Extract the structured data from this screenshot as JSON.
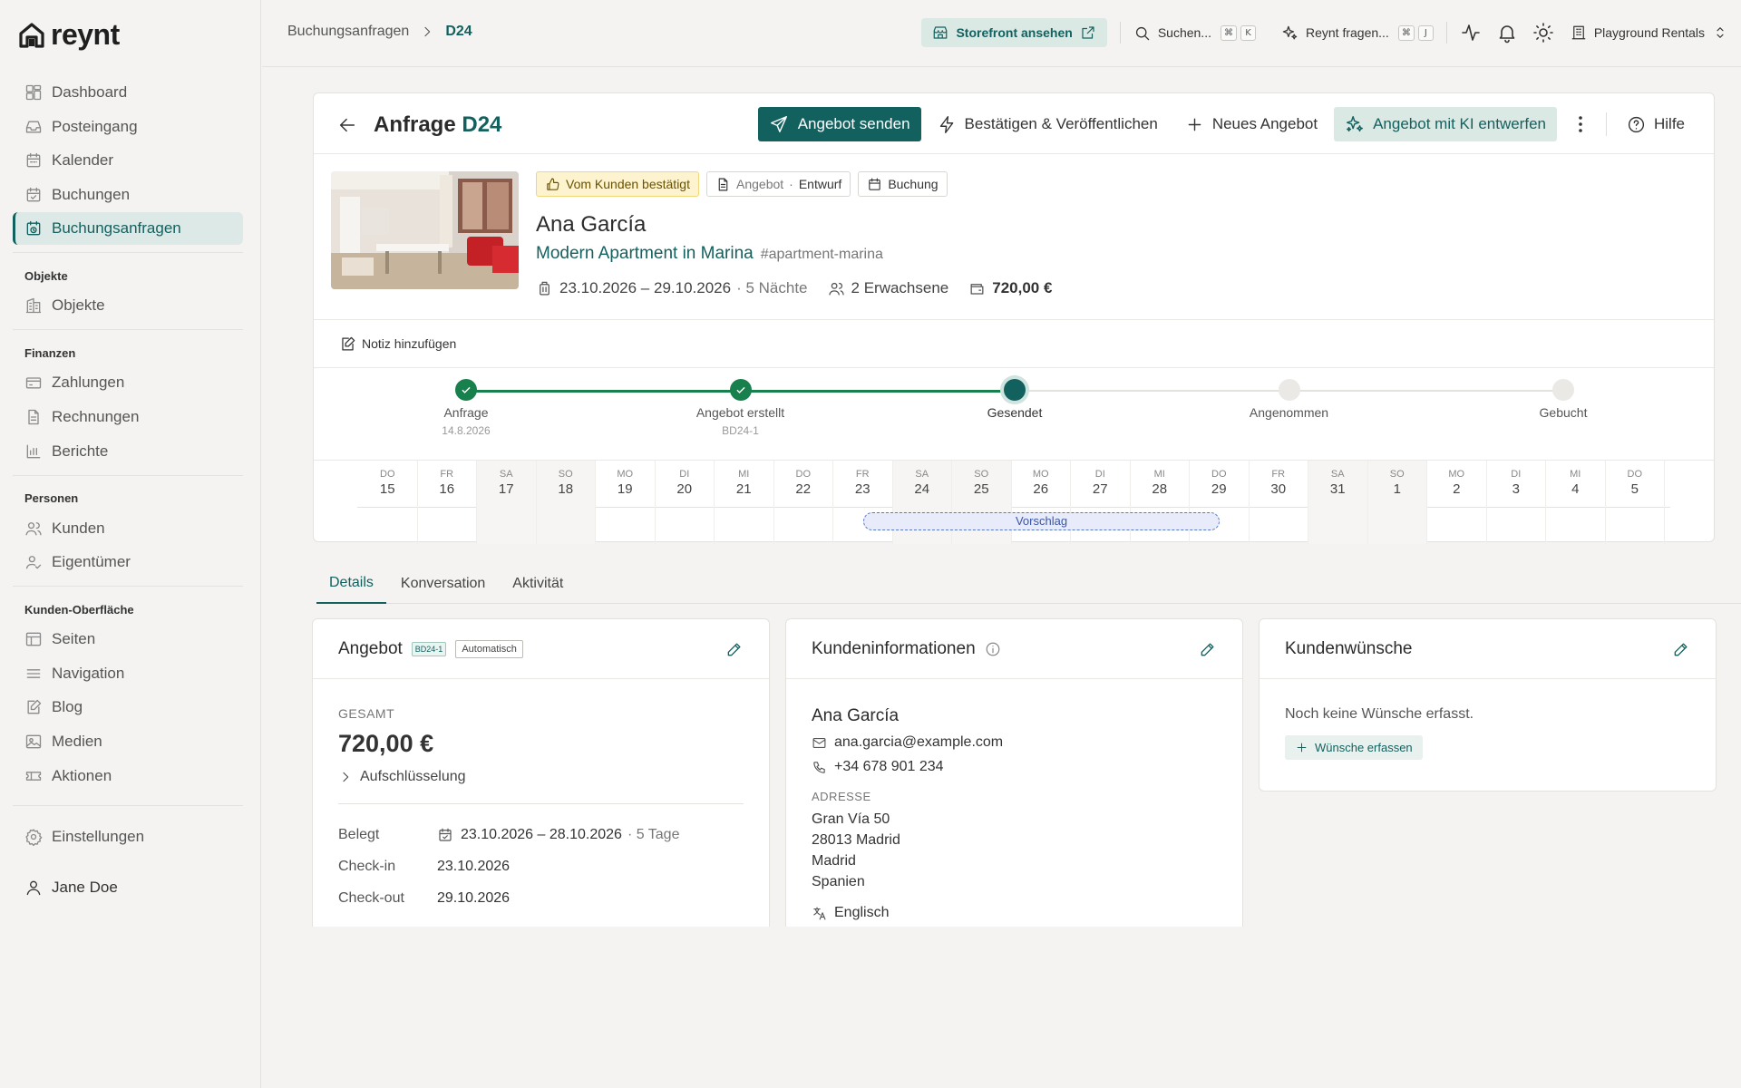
{
  "app": {
    "logo_text": "reynt"
  },
  "sidebar": {
    "group1": [
      {
        "label": "Dashboard",
        "icon": "dashboard-icon"
      },
      {
        "label": "Posteingang",
        "icon": "inbox-icon"
      },
      {
        "label": "Kalender",
        "icon": "calendar-icon"
      },
      {
        "label": "Buchungen",
        "icon": "bookings-icon"
      },
      {
        "label": "Buchungsanfragen",
        "icon": "booking-requests-icon",
        "active": true
      }
    ],
    "sections": {
      "objekte": "Objekte",
      "finanzen": "Finanzen",
      "personen": "Personen",
      "kunden_oberflaeche": "Kunden-Oberfläche"
    },
    "objekte": [
      {
        "label": "Objekte",
        "icon": "building-icon"
      }
    ],
    "finanzen": [
      {
        "label": "Zahlungen",
        "icon": "payments-icon"
      },
      {
        "label": "Rechnungen",
        "icon": "invoices-icon"
      },
      {
        "label": "Berichte",
        "icon": "reports-icon"
      }
    ],
    "personen": [
      {
        "label": "Kunden",
        "icon": "customers-icon"
      },
      {
        "label": "Eigentümer",
        "icon": "owners-icon"
      }
    ],
    "kunden_oberflaeche": [
      {
        "label": "Seiten",
        "icon": "pages-icon"
      },
      {
        "label": "Navigation",
        "icon": "navigation-icon"
      },
      {
        "label": "Blog",
        "icon": "blog-icon"
      },
      {
        "label": "Medien",
        "icon": "media-icon"
      },
      {
        "label": "Aktionen",
        "icon": "promotions-icon"
      }
    ],
    "settings": "Einstellungen",
    "user": "Jane Doe"
  },
  "topbar": {
    "breadcrumb_parent": "Buchungsanfragen",
    "breadcrumb_current": "D24",
    "storefront_label": "Storefront ansehen",
    "search_label": "Suchen...",
    "search_keys": [
      "⌘",
      "K"
    ],
    "ask_label": "Reynt fragen...",
    "ask_keys": [
      "⌘",
      "J"
    ],
    "org_name": "Playground Rentals"
  },
  "request": {
    "title_prefix": "Anfrage",
    "title_code": "D24",
    "actions": {
      "send_offer": "Angebot senden",
      "confirm_publish": "Bestätigen & Veröffentlichen",
      "new_offer": "Neues Angebot",
      "ai_draft": "Angebot mit KI entwerfen",
      "help": "Hilfe"
    },
    "badges": {
      "confirmed": "Vom Kunden bestätigt",
      "offer_prefix": "Angebot",
      "offer_sep": "·",
      "offer_state": "Entwurf",
      "booking": "Buchung"
    },
    "guest_name": "Ana García",
    "listing_name": "Modern Apartment in Marina",
    "listing_slug": "#apartment-marina",
    "dates": "23.10.2026 – 29.10.2026",
    "nights": "· 5 Nächte",
    "guests": "2 Erwachsene",
    "price": "720,00 €",
    "add_note": "Notiz hinzufügen"
  },
  "steps": [
    {
      "label": "Anfrage",
      "sub": "14.8.2026",
      "state": "done"
    },
    {
      "label": "Angebot erstellt",
      "sub": "BD24-1",
      "state": "done"
    },
    {
      "label": "Gesendet",
      "sub": "",
      "state": "current"
    },
    {
      "label": "Angenommen",
      "sub": "",
      "state": "todo"
    },
    {
      "label": "Gebucht",
      "sub": "",
      "state": "todo"
    }
  ],
  "calendar": {
    "days": [
      {
        "dow": "DO",
        "num": "15"
      },
      {
        "dow": "FR",
        "num": "16"
      },
      {
        "dow": "SA",
        "num": "17",
        "we": true
      },
      {
        "dow": "SO",
        "num": "18",
        "we": true
      },
      {
        "dow": "MO",
        "num": "19"
      },
      {
        "dow": "DI",
        "num": "20"
      },
      {
        "dow": "MI",
        "num": "21"
      },
      {
        "dow": "DO",
        "num": "22"
      },
      {
        "dow": "FR",
        "num": "23"
      },
      {
        "dow": "SA",
        "num": "24",
        "we": true
      },
      {
        "dow": "SO",
        "num": "25",
        "we": true
      },
      {
        "dow": "MO",
        "num": "26"
      },
      {
        "dow": "DI",
        "num": "27"
      },
      {
        "dow": "MI",
        "num": "28"
      },
      {
        "dow": "DO",
        "num": "29"
      },
      {
        "dow": "FR",
        "num": "30"
      },
      {
        "dow": "SA",
        "num": "31",
        "we": true
      },
      {
        "dow": "SO",
        "num": "1",
        "we": true
      },
      {
        "dow": "MO",
        "num": "2"
      },
      {
        "dow": "DI",
        "num": "3"
      },
      {
        "dow": "MI",
        "num": "4"
      },
      {
        "dow": "DO",
        "num": "5"
      }
    ],
    "proposal_label": "Vorschlag",
    "proposal_start_day": "23",
    "proposal_end_day": "29"
  },
  "tabs": [
    "Details",
    "Konversation",
    "Aktivität"
  ],
  "offer_card": {
    "title": "Angebot",
    "code_chip": "BD24-1",
    "auto_chip": "Automatisch",
    "total_label": "GESAMT",
    "total_value": "720,00 €",
    "breakdown": "Aufschlüsselung",
    "occupied_label": "Belegt",
    "occupied_value": "23.10.2026 – 28.10.2026",
    "occupied_days": "· 5 Tage",
    "checkin_label": "Check-in",
    "checkin_value": "23.10.2026",
    "checkout_label": "Check-out",
    "checkout_value": "29.10.2026"
  },
  "customer_card": {
    "title": "Kundeninformationen",
    "name": "Ana García",
    "email": "ana.garcia@example.com",
    "phone": "+34 678 901 234",
    "address_label": "ADRESSE",
    "address": [
      "Gran Vía 50",
      "28013 Madrid",
      "Madrid",
      "Spanien"
    ],
    "language": "Englisch"
  },
  "wishes_card": {
    "title": "Kundenwünsche",
    "empty": "Noch keine Wünsche erfasst.",
    "add_button": "Wünsche erfassen"
  },
  "colors": {
    "brand": "#13615f",
    "success": "#18804c",
    "proposal": "#5b78c4"
  }
}
